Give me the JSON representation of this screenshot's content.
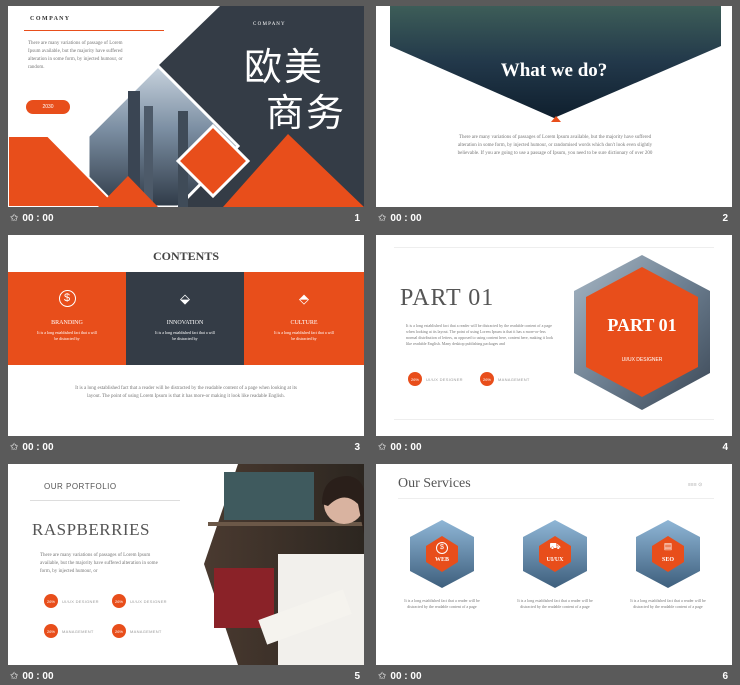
{
  "colors": {
    "accent": "#e84e1b",
    "dark": "#343c46",
    "bg": "#5a5a5a"
  },
  "slides": [
    {
      "number": "1",
      "time": "00 : 00",
      "company_left": "C O M P A N Y",
      "company_right": "C O M P A N Y",
      "body": "There are many variations of passage of Lorem Ipsum available, but the majority have suffered alteration in some form, by injected humour, or random.",
      "button": "2030",
      "title_line1": "欧美",
      "title_line2": "商务"
    },
    {
      "number": "2",
      "time": "00 : 00",
      "title": "What we do?",
      "body": "There are many variations of passages of Lorem Ipsum available, but the majority have suffered alteration in some form, by injected humour, or randomised words which don't look even slightly believable. If you are going to use a passage of  Ipsum, you need to be sure dictionary of over 200"
    },
    {
      "number": "3",
      "time": "00 : 00",
      "title": "CONTENTS",
      "cards": [
        {
          "label": "BRANDING",
          "text": "It is a long established fact that a will be distracted by",
          "icon": "dollar-icon"
        },
        {
          "label": "INNOVATION",
          "text": "It is a long established fact that a will be distracted by",
          "icon": "tags-icon"
        },
        {
          "label": "CULTURE",
          "text": "It is a long established fact that a will be distracted by",
          "icon": "tag-icon"
        }
      ],
      "body": "It is a long established fact that a reader will be distracted by the readable content of a page when looking at its layout. The point of using Lorem Ipsum is that it has more-or making it look like readable English."
    },
    {
      "number": "4",
      "time": "00 : 00",
      "title": "PART 01",
      "hex_title": "PART 01",
      "hex_sub": "UI/UX DESIGNER",
      "body": "It is a long established fact that a reader will be distracted by the readable content of a page when looking at its layout. The point of using Lorem Ipsum is that it has a more-or-less normal distribution of letters, as opposed to using content here, content here, making it look like readable English. Many desktop publishing packages and",
      "stats": [
        {
          "value": "26%",
          "label": "UI/UX DESIGNER"
        },
        {
          "value": "26%",
          "label": "MANAGEMENT"
        }
      ]
    },
    {
      "number": "5",
      "time": "00 : 00",
      "kicker": "OUR PORTFOLIO",
      "title": "RASPBERRIES",
      "body": "There are many variations of passages of Lorem Ipsum available, but the majority have suffered alteration in some form, by injected humour, or",
      "stats": [
        {
          "value": "26%",
          "label": "UI/UX DESIGNER"
        },
        {
          "value": "26%",
          "label": "UI/UX DESIGNER"
        },
        {
          "value": "26%",
          "label": "MANAGEMENT"
        },
        {
          "value": "26%",
          "label": "MANAGEMENT"
        }
      ]
    },
    {
      "number": "6",
      "time": "00 : 00",
      "title": "Our Services",
      "menu": "≡≡≡ ⊙",
      "services": [
        {
          "label": "WEB",
          "text": "It is a long established fact that a reader will be distracted by the readable content of a page",
          "icon": "dollar-icon"
        },
        {
          "label": "UI/UX",
          "text": "It is a long established fact that a reader will be distracted by the readable content of a page",
          "icon": "cart-icon"
        },
        {
          "label": "SEO",
          "text": "It is a long established fact that a reader will be distracted by the readable content of a page",
          "icon": "document-icon"
        }
      ]
    }
  ]
}
